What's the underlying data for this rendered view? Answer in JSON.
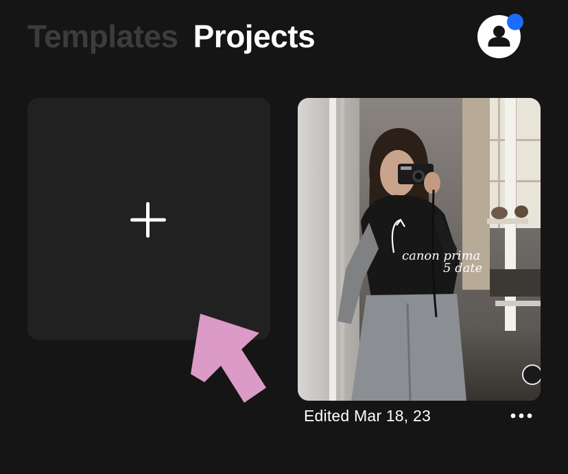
{
  "header": {
    "tabs": [
      {
        "label": "Templates",
        "active": false
      },
      {
        "label": "Projects",
        "active": true
      }
    ],
    "avatar_icon": "person-icon",
    "notification_color": "#1a6dff"
  },
  "main": {
    "new_project_icon": "plus-icon",
    "projects": [
      {
        "thumbnail_alt": "Mirror selfie with camera",
        "thumbnail_text_line1": "canon prima",
        "thumbnail_text_line2": "5 date",
        "edited_label": "Edited Mar 18, 23",
        "menu_icon": "more-horizontal-icon"
      }
    ]
  },
  "overlay": {
    "annotation_arrow_color": "#dc9ac6"
  }
}
